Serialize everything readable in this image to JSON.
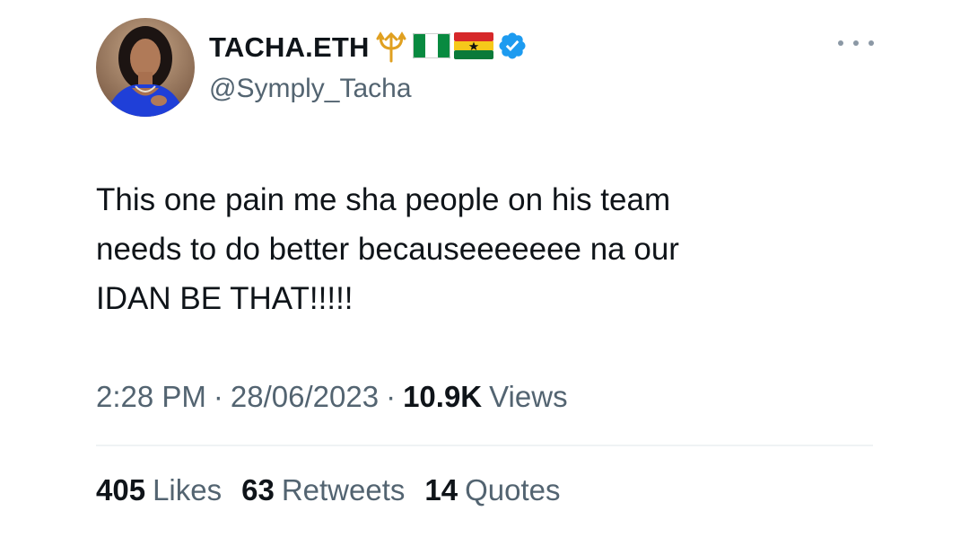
{
  "user": {
    "display_name": "TACHA.ETH",
    "handle": "@Symply_Tacha",
    "badges": [
      "trident-emoji",
      "nigeria-flag-emoji",
      "ghana-flag-emoji",
      "verified-badge"
    ]
  },
  "tweet": {
    "text": "This one pain me sha people on his team\nneeds to do better becauseeeeeee na our\nIDAN BE THAT!!!!!",
    "time": "2:28 PM",
    "date": "28/06/2023",
    "views_count": "10.9K",
    "views_label": "Views"
  },
  "stats": {
    "likes_count": "405",
    "likes_label": "Likes",
    "retweets_count": "63",
    "retweets_label": "Retweets",
    "quotes_count": "14",
    "quotes_label": "Quotes"
  },
  "colors": {
    "verified": "#1d9bf0",
    "secondary_text": "#536471",
    "primary_text": "#0f1419",
    "divider": "#eff3f4"
  }
}
